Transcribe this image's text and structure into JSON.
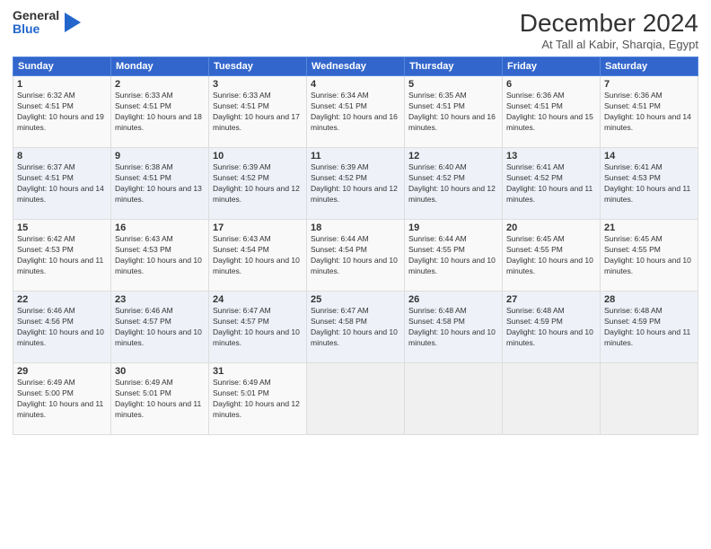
{
  "header": {
    "logo_general": "General",
    "logo_blue": "Blue",
    "month_title": "December 2024",
    "location": "At Tall al Kabir, Sharqia, Egypt"
  },
  "days_of_week": [
    "Sunday",
    "Monday",
    "Tuesday",
    "Wednesday",
    "Thursday",
    "Friday",
    "Saturday"
  ],
  "weeks": [
    [
      {
        "day": "1",
        "rise": "6:32 AM",
        "set": "4:51 PM",
        "daylight": "10 hours and 19 minutes."
      },
      {
        "day": "2",
        "rise": "6:33 AM",
        "set": "4:51 PM",
        "daylight": "10 hours and 18 minutes."
      },
      {
        "day": "3",
        "rise": "6:33 AM",
        "set": "4:51 PM",
        "daylight": "10 hours and 17 minutes."
      },
      {
        "day": "4",
        "rise": "6:34 AM",
        "set": "4:51 PM",
        "daylight": "10 hours and 16 minutes."
      },
      {
        "day": "5",
        "rise": "6:35 AM",
        "set": "4:51 PM",
        "daylight": "10 hours and 16 minutes."
      },
      {
        "day": "6",
        "rise": "6:36 AM",
        "set": "4:51 PM",
        "daylight": "10 hours and 15 minutes."
      },
      {
        "day": "7",
        "rise": "6:36 AM",
        "set": "4:51 PM",
        "daylight": "10 hours and 14 minutes."
      }
    ],
    [
      {
        "day": "8",
        "rise": "6:37 AM",
        "set": "4:51 PM",
        "daylight": "10 hours and 14 minutes."
      },
      {
        "day": "9",
        "rise": "6:38 AM",
        "set": "4:51 PM",
        "daylight": "10 hours and 13 minutes."
      },
      {
        "day": "10",
        "rise": "6:39 AM",
        "set": "4:52 PM",
        "daylight": "10 hours and 12 minutes."
      },
      {
        "day": "11",
        "rise": "6:39 AM",
        "set": "4:52 PM",
        "daylight": "10 hours and 12 minutes."
      },
      {
        "day": "12",
        "rise": "6:40 AM",
        "set": "4:52 PM",
        "daylight": "10 hours and 12 minutes."
      },
      {
        "day": "13",
        "rise": "6:41 AM",
        "set": "4:52 PM",
        "daylight": "10 hours and 11 minutes."
      },
      {
        "day": "14",
        "rise": "6:41 AM",
        "set": "4:53 PM",
        "daylight": "10 hours and 11 minutes."
      }
    ],
    [
      {
        "day": "15",
        "rise": "6:42 AM",
        "set": "4:53 PM",
        "daylight": "10 hours and 11 minutes."
      },
      {
        "day": "16",
        "rise": "6:43 AM",
        "set": "4:53 PM",
        "daylight": "10 hours and 10 minutes."
      },
      {
        "day": "17",
        "rise": "6:43 AM",
        "set": "4:54 PM",
        "daylight": "10 hours and 10 minutes."
      },
      {
        "day": "18",
        "rise": "6:44 AM",
        "set": "4:54 PM",
        "daylight": "10 hours and 10 minutes."
      },
      {
        "day": "19",
        "rise": "6:44 AM",
        "set": "4:55 PM",
        "daylight": "10 hours and 10 minutes."
      },
      {
        "day": "20",
        "rise": "6:45 AM",
        "set": "4:55 PM",
        "daylight": "10 hours and 10 minutes."
      },
      {
        "day": "21",
        "rise": "6:45 AM",
        "set": "4:55 PM",
        "daylight": "10 hours and 10 minutes."
      }
    ],
    [
      {
        "day": "22",
        "rise": "6:46 AM",
        "set": "4:56 PM",
        "daylight": "10 hours and 10 minutes."
      },
      {
        "day": "23",
        "rise": "6:46 AM",
        "set": "4:57 PM",
        "daylight": "10 hours and 10 minutes."
      },
      {
        "day": "24",
        "rise": "6:47 AM",
        "set": "4:57 PM",
        "daylight": "10 hours and 10 minutes."
      },
      {
        "day": "25",
        "rise": "6:47 AM",
        "set": "4:58 PM",
        "daylight": "10 hours and 10 minutes."
      },
      {
        "day": "26",
        "rise": "6:48 AM",
        "set": "4:58 PM",
        "daylight": "10 hours and 10 minutes."
      },
      {
        "day": "27",
        "rise": "6:48 AM",
        "set": "4:59 PM",
        "daylight": "10 hours and 10 minutes."
      },
      {
        "day": "28",
        "rise": "6:48 AM",
        "set": "4:59 PM",
        "daylight": "10 hours and 11 minutes."
      }
    ],
    [
      {
        "day": "29",
        "rise": "6:49 AM",
        "set": "5:00 PM",
        "daylight": "10 hours and 11 minutes."
      },
      {
        "day": "30",
        "rise": "6:49 AM",
        "set": "5:01 PM",
        "daylight": "10 hours and 11 minutes."
      },
      {
        "day": "31",
        "rise": "6:49 AM",
        "set": "5:01 PM",
        "daylight": "10 hours and 12 minutes."
      },
      null,
      null,
      null,
      null
    ]
  ]
}
